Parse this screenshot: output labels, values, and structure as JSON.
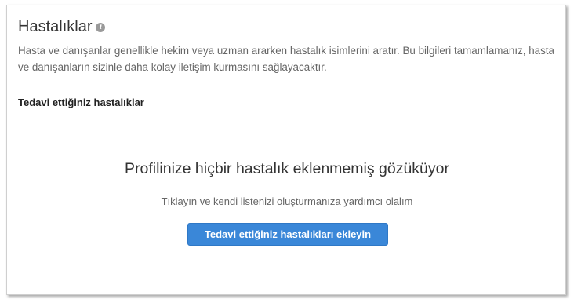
{
  "header": {
    "title": "Hastalıklar",
    "info_icon": "info-icon"
  },
  "description": "Hasta ve danışanlar genellikle hekim veya uzman ararken hastalık isimlerini aratır. Bu bilgileri tamamlamanız, hasta ve danışanların sizinle daha kolay iletişim kurmasını sağlayacaktır.",
  "section": {
    "heading": "Tedavi ettiğiniz hastalıklar"
  },
  "empty_state": {
    "title": "Profilinize hiçbir hastalık eklenmemiş gözüküyor",
    "subtitle": "Tıklayın ve kendi listenizi oluşturmanıza yardımcı olalım",
    "button_label": "Tedavi ettiğiniz hastalıkları ekleyin"
  },
  "colors": {
    "accent": "#3a87d8",
    "text": "#333333",
    "muted": "#666666"
  }
}
